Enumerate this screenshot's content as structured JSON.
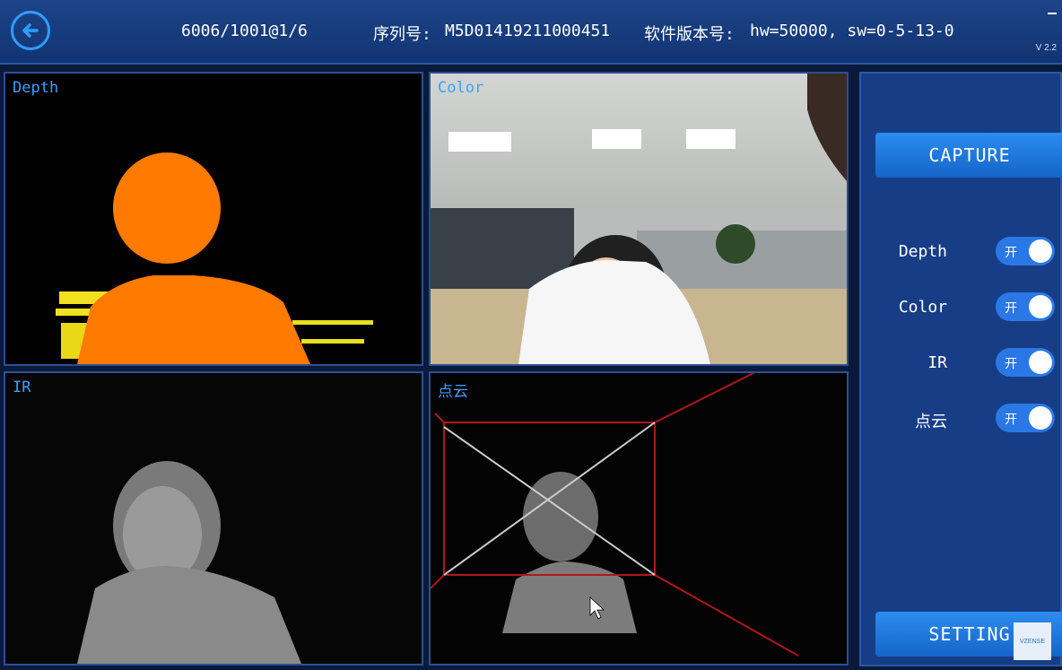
{
  "header": {
    "device_id": "6006/1001@1/6",
    "serial_label": "序列号:",
    "serial_value": "M5D01419211000451",
    "version_label": "软件版本号:",
    "version_value": "hw=50000, sw=0-5-13-0",
    "app_version": "V 2.2"
  },
  "panels": {
    "depth": "Depth",
    "color": "Color",
    "ir": "IR",
    "pointcloud": "点云"
  },
  "sidebar": {
    "capture": "CAPTURE",
    "setting": "SETTING",
    "toggles": [
      {
        "label": "Depth",
        "state": "开"
      },
      {
        "label": "Color",
        "state": "开"
      },
      {
        "label": "IR",
        "state": "开"
      },
      {
        "label": "点云",
        "state": "开"
      }
    ]
  },
  "logo_text": "VZENSE",
  "colors": {
    "accent": "#2a78e6",
    "label": "#3aa0ff",
    "depth_fill": "#ff7a00"
  }
}
